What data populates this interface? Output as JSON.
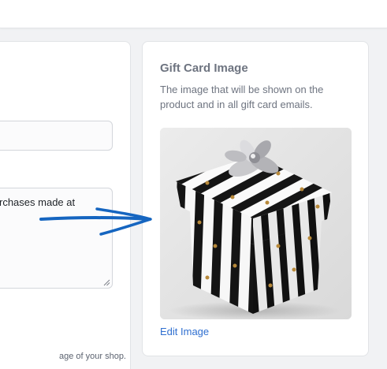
{
  "form": {
    "description_value": "rchases made at",
    "help_text": "age of your shop."
  },
  "gift_card_image": {
    "title": "Gift Card Image",
    "description": "The image that will be shown on the product and in all gift card emails.",
    "edit_link": "Edit Image",
    "image_subject": "striped-gift-box-with-silver-bow"
  },
  "annotation": {
    "arrow_color": "#1565c0"
  },
  "colors": {
    "link": "#2f6fd0",
    "muted_text": "#6e7480",
    "page_bg": "#f1f2f4"
  }
}
